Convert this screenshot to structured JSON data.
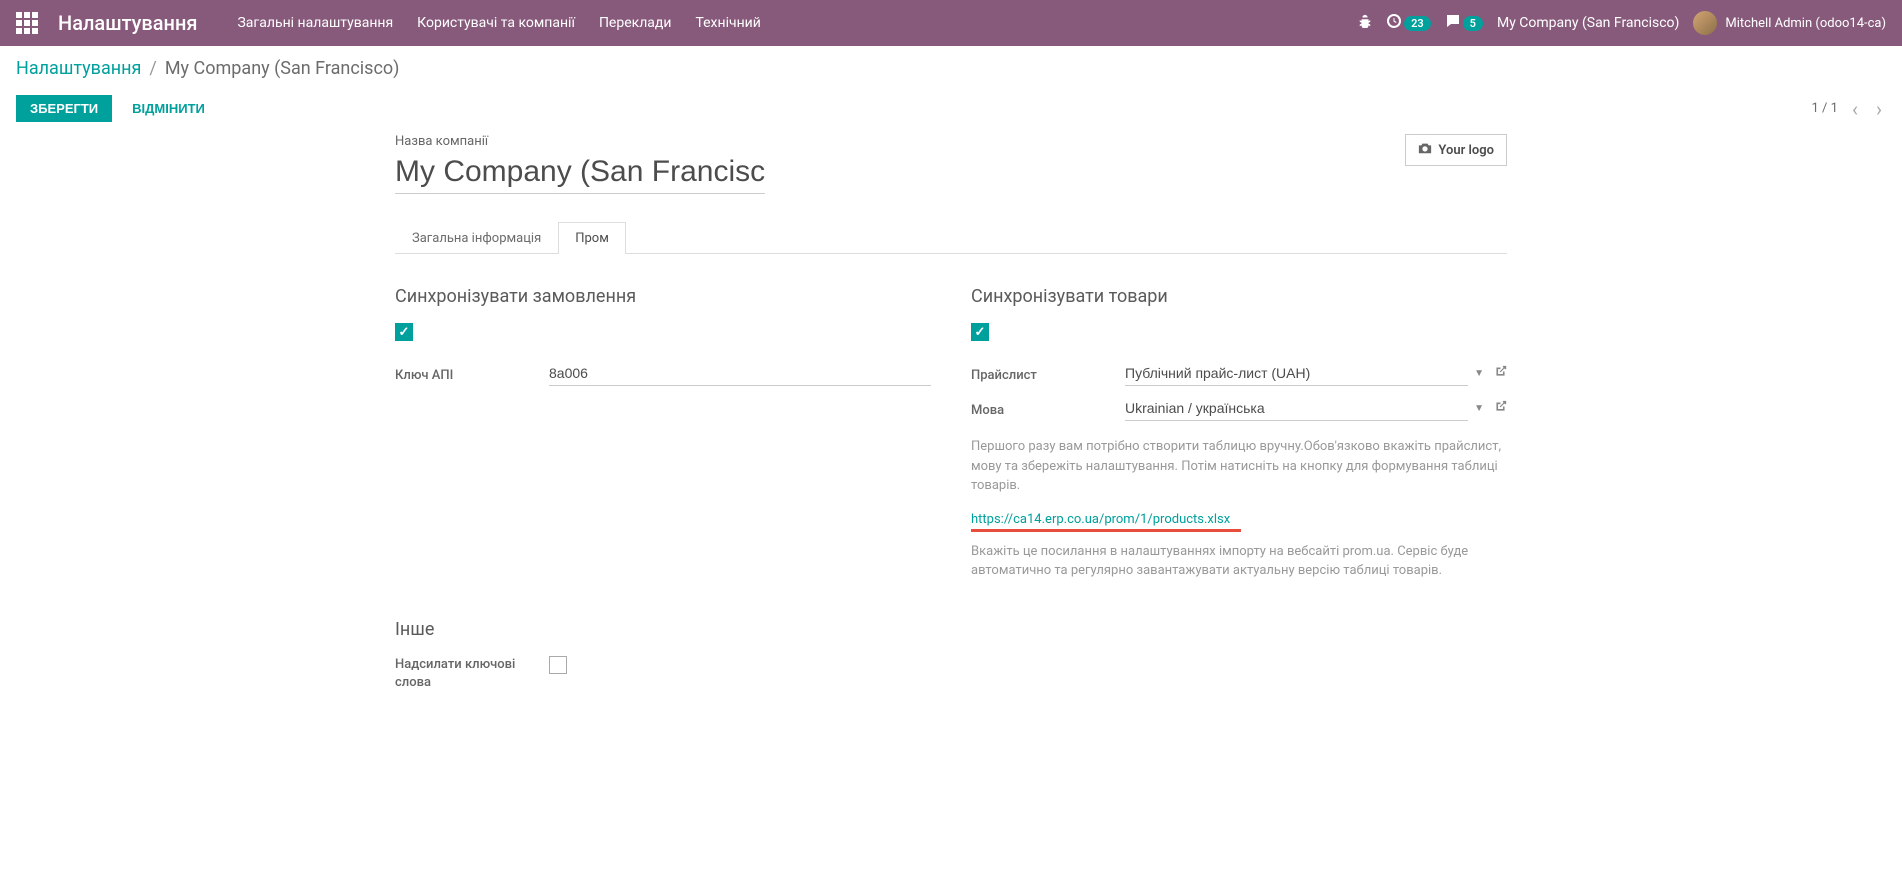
{
  "nav": {
    "brand": "Налаштування",
    "menu": [
      "Загальні налаштування",
      "Користувачі та компанії",
      "Переклади",
      "Технічний"
    ],
    "badge_activities": "23",
    "badge_messages": "5",
    "company": "My Company (San Francisco)",
    "user": "Mitchell Admin (odoo14-ca)"
  },
  "breadcrumb": {
    "root": "Налаштування",
    "current": "My Company (San Francisco)"
  },
  "actions": {
    "save": "ЗБЕРЕГТИ",
    "discard": "ВІДМІНИТИ",
    "pager": "1 / 1"
  },
  "form": {
    "company_label": "Назва компанії",
    "company_value": "My Company (San Francisco)",
    "logo_text": "Your logo"
  },
  "tabs": {
    "general": "Загальна інформація",
    "prom": "Пром"
  },
  "left": {
    "sync_orders_title": "Синхронізувати замовлення",
    "api_key_label": "Ключ АПІ",
    "api_key_value": "8a006"
  },
  "right": {
    "sync_products_title": "Синхронізувати товари",
    "pricelist_label": "Прайслист",
    "pricelist_value": "Публічний прайс-лист (UAH)",
    "language_label": "Мова",
    "language_value": "Ukrainian / українська",
    "help1": "Першого разу вам потрібно створити таблицю вручну.Обов'язково вкажіть прайслист, мову та збережіть налаштування. Потім натисніть на кнопку для формування таблиці товарів.",
    "products_link": "https://ca14.erp.co.ua/prom/1/products.xlsx",
    "help2": "Вкажіть це посилання в налаштуваннях імпорту на вебсайті prom.ua. Сервіс буде автоматично та регулярно завантажувати актуальну версію таблиці товарів."
  },
  "other": {
    "title": "Інше",
    "keywords_label": "Надсилати ключові слова"
  }
}
